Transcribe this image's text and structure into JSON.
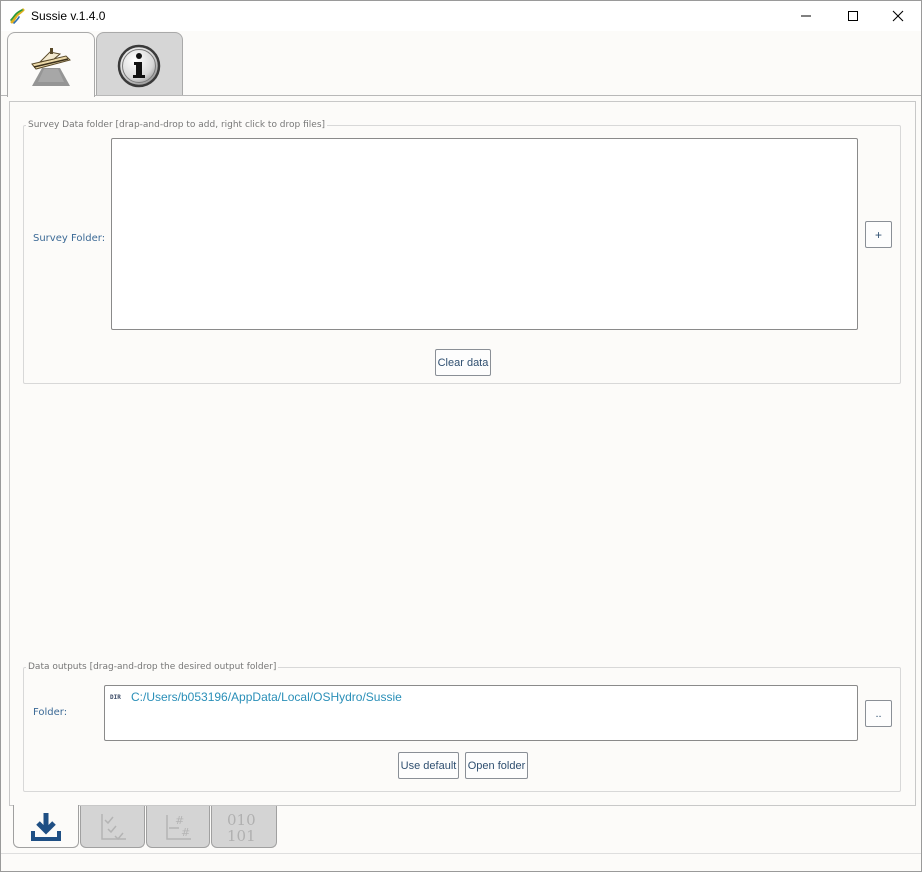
{
  "window": {
    "title": "Sussie v.1.4.0"
  },
  "top_tabs": [
    {
      "name": "survey-tab",
      "icon": "survey-boat-icon",
      "selected": true
    },
    {
      "name": "info-tab",
      "icon": "info-icon",
      "selected": false
    }
  ],
  "survey_group": {
    "legend": "Survey Data folder  [drap-and-drop to add, right click to drop files]",
    "label": "Survey Folder:",
    "add_label": "+",
    "clear_label": "Clear data"
  },
  "output_group": {
    "legend": "Data outputs [drag-and-drop the desired output folder]",
    "label": "Folder:",
    "dir_tag": "DIR",
    "path": "C:/Users/b053196/AppData/Local/OSHydro/Sussie",
    "browse_label": "..",
    "use_default_label": "Use default",
    "open_folder_label": "Open folder"
  },
  "bottom_tabs": [
    {
      "name": "import-tab",
      "icon": "download-icon",
      "selected": true
    },
    {
      "name": "checks-tab",
      "icon": "checklist-icon",
      "selected": false
    },
    {
      "name": "number-tab",
      "icon": "hash-list-icon",
      "selected": false
    },
    {
      "name": "binary-tab",
      "icon": "binary-icon",
      "selected": false,
      "text": "010 101"
    }
  ],
  "colors": {
    "label_blue": "#3c6a96",
    "path_blue": "#2a8fb8",
    "download_blue": "#1f4f84"
  }
}
